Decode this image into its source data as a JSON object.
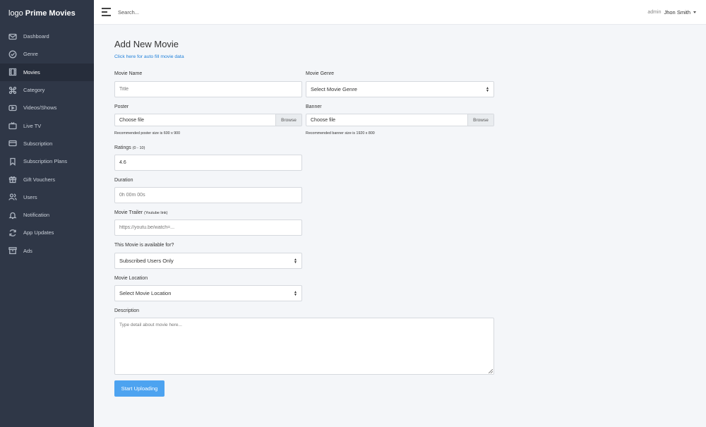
{
  "brand": {
    "logo_word": "logo",
    "name": "Prime Movies"
  },
  "sidebar": {
    "items": [
      {
        "label": "Dashboard",
        "icon": "mail-icon"
      },
      {
        "label": "Genre",
        "icon": "check-circle-icon"
      },
      {
        "label": "Movies",
        "icon": "film-icon",
        "active": true
      },
      {
        "label": "Category",
        "icon": "command-icon"
      },
      {
        "label": "Videos/Shows",
        "icon": "video-icon"
      },
      {
        "label": "Live TV",
        "icon": "tv-icon"
      },
      {
        "label": "Subscription",
        "icon": "card-icon"
      },
      {
        "label": "Subscription Plans",
        "icon": "bookmark-icon"
      },
      {
        "label": "Gift Vouchers",
        "icon": "gift-icon"
      },
      {
        "label": "Users",
        "icon": "users-icon"
      },
      {
        "label": "Notification",
        "icon": "bell-icon"
      },
      {
        "label": "App Updates",
        "icon": "refresh-icon"
      },
      {
        "label": "Ads",
        "icon": "archive-icon"
      }
    ]
  },
  "topbar": {
    "search_placeholder": "Search...",
    "role": "admin",
    "username": "Jhon Smith"
  },
  "form": {
    "title": "Add New Movie",
    "autofill_link": "Click here for auto fill movie data",
    "movie_name": {
      "label": "Movie Name",
      "placeholder": "Title"
    },
    "movie_genre": {
      "label": "Movie Genre",
      "value": "Select Movie Genre"
    },
    "poster": {
      "label": "Poster",
      "file_text": "Choose file",
      "browse": "Browse",
      "hint": "Recommended poster size is 600 x 900"
    },
    "banner": {
      "label": "Banner",
      "file_text": "Choose file",
      "browse": "Browse",
      "hint": "Recommended banner size is 1920 x 800"
    },
    "ratings": {
      "label": "Ratings",
      "sub": "(0 - 10)",
      "value": "4.6"
    },
    "duration": {
      "label": "Duration",
      "placeholder": "0h 00m 00s"
    },
    "trailer": {
      "label": "Movie Trailer",
      "sub": "(Youtube link)",
      "placeholder": "https://youtu.be/watch=..."
    },
    "availability": {
      "label": "This Movie is available for?",
      "value": "Subscribed Users Only"
    },
    "location": {
      "label": "Movie Location",
      "value": "Select Movie Location"
    },
    "description": {
      "label": "Description",
      "placeholder": "Type detail about movie here..."
    },
    "submit": "Start Uploading"
  }
}
